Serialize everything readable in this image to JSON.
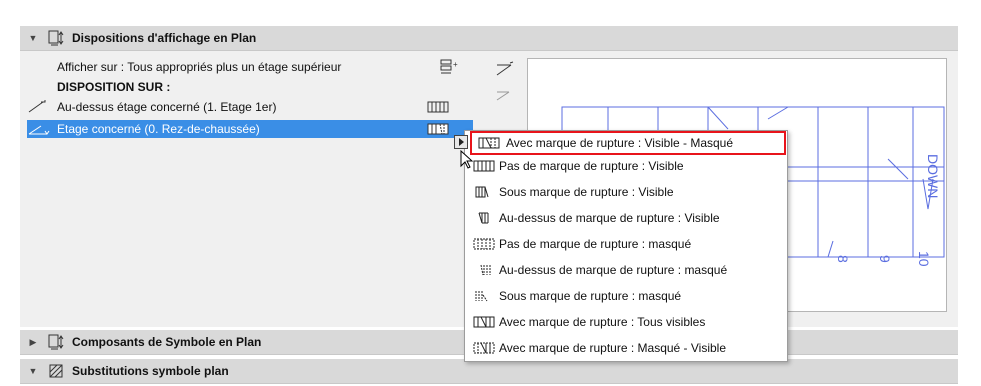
{
  "sections": {
    "plan_display": {
      "title": "Dispositions d'affichage en Plan",
      "expanded": true
    },
    "symbol_components": {
      "title": "Composants de Symbole en Plan",
      "expanded": false
    },
    "symbol_substitutions": {
      "title": "Substitutions symbole plan",
      "expanded": true
    }
  },
  "plan_display": {
    "show_on": "Afficher sur : Tous appropriés plus un étage supérieur",
    "disposition_header": "DISPOSITION SUR :",
    "rows": [
      {
        "label": "Au-dessus étage concerné (1. Etage 1er)",
        "selected": false
      },
      {
        "label": "Etage concerné (0. Rez-de-chaussée)",
        "selected": true
      }
    ]
  },
  "dropdown": {
    "items": [
      {
        "label": "Avec marque de rupture : Visible - Masqué",
        "highlighted": true
      },
      {
        "label": "Pas de marque de rupture : Visible",
        "highlighted": false
      },
      {
        "label": "Sous marque de rupture : Visible",
        "highlighted": false
      },
      {
        "label": "Au-dessus de marque de rupture : Visible",
        "highlighted": false
      },
      {
        "label": "Pas de marque de rupture : masqué",
        "highlighted": false
      },
      {
        "label": "Au-dessus de marque de rupture : masqué",
        "highlighted": false
      },
      {
        "label": "Sous marque de rupture : masqué",
        "highlighted": false
      },
      {
        "label": "Avec marque de rupture : Tous visibles",
        "highlighted": false
      },
      {
        "label": "Avec marque de rupture : Masqué - Visible",
        "highlighted": false
      }
    ]
  },
  "preview": {
    "stair_text": "DOWN",
    "digits": [
      "8",
      "9",
      "10"
    ]
  },
  "colors": {
    "selection": "#3a8ee6",
    "highlight_border": "#e8141b",
    "stair_lines": "#5b6ee0"
  }
}
